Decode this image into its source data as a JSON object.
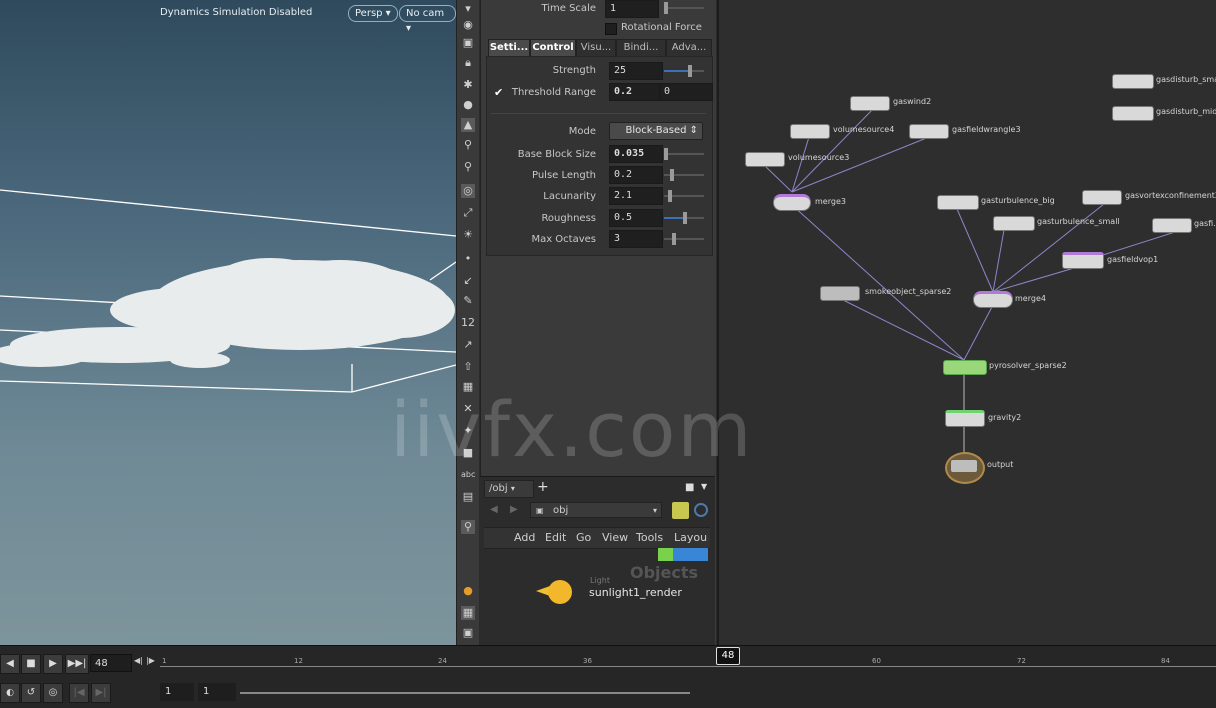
{
  "viewport": {
    "title": "Dynamics Simulation Disabled",
    "camera_mode": "Persp",
    "camera": "No cam"
  },
  "params": {
    "time_scale_label": "Time Scale",
    "time_scale_value": "1",
    "rotational_force_label": "Rotational Force",
    "tabs": [
      "Setti...",
      "Control",
      "Visu...",
      "Bindi...",
      "Adva..."
    ],
    "strength_label": "Strength",
    "strength_value": "25",
    "threshold_label": "Threshold Range",
    "threshold_min": "0.2",
    "threshold_max": "0",
    "mode_label": "Mode",
    "mode_value": "Block-Based",
    "base_block_label": "Base Block Size",
    "base_block_value": "0.035",
    "pulse_label": "Pulse Length",
    "pulse_value": "0.2",
    "lacunarity_label": "Lacunarity",
    "lacunarity_value": "2.1",
    "roughness_label": "Roughness",
    "roughness_value": "0.5",
    "octaves_label": "Max Octaves",
    "octaves_value": "3"
  },
  "objpane": {
    "tab_label": "/obj",
    "path": "obj",
    "menu": [
      "Add",
      "Edit",
      "Go",
      "View",
      "Tools",
      "Layou"
    ],
    "overlay_label": "Objects",
    "node_type": "Light",
    "node_name": "sunlight1_render"
  },
  "network": {
    "nodes": [
      {
        "name": "gasdisturb_small"
      },
      {
        "name": "gasdisturb_mid"
      },
      {
        "name": "gaswind2"
      },
      {
        "name": "volumesource4"
      },
      {
        "name": "gasfieldwrangle3"
      },
      {
        "name": "volumesource3"
      },
      {
        "name": "merge3"
      },
      {
        "name": "gasturbulence_big"
      },
      {
        "name": "gasvortexconfinement2"
      },
      {
        "name": "gasturbulence_small"
      },
      {
        "name": "gasfi..."
      },
      {
        "name": "gasfieldvop1"
      },
      {
        "name": "smokeobject_sparse2"
      },
      {
        "name": "merge4"
      },
      {
        "name": "pyrosolver_sparse2"
      },
      {
        "name": "gravity2"
      },
      {
        "name": "output"
      }
    ]
  },
  "timeline": {
    "current_frame": "48",
    "marker": "48",
    "ticks": [
      "1",
      "12",
      "24",
      "36",
      "60",
      "72",
      "84"
    ],
    "range_start": "1",
    "range_end": "1"
  },
  "watermark": "iivfx.com"
}
